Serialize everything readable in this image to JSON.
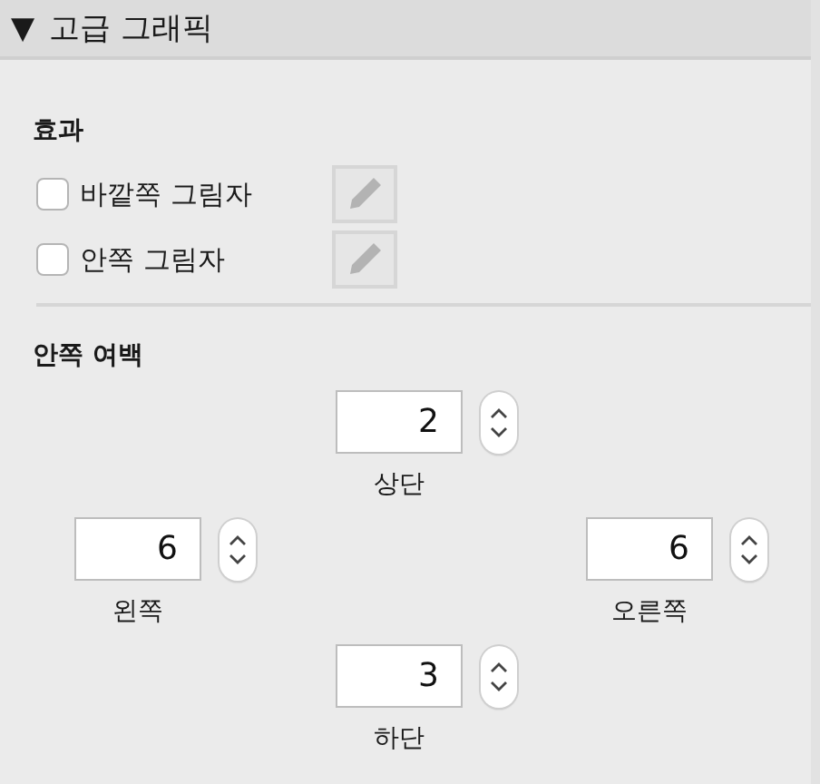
{
  "header": {
    "disclosure": "▼",
    "title": "고급 그래픽",
    "expanded": true
  },
  "effects": {
    "heading": "효과",
    "options": [
      {
        "label": "바깥쪽 그림자",
        "checked": false
      },
      {
        "label": "안쪽 그림자",
        "checked": false
      }
    ]
  },
  "padding": {
    "heading": "안쪽 여백",
    "fields": [
      {
        "kind": "top",
        "label": "상단",
        "value": "2"
      },
      {
        "kind": "left",
        "label": "왼쪽",
        "value": "6"
      },
      {
        "kind": "right",
        "label": "오른쪽",
        "value": "6"
      },
      {
        "kind": "bottom",
        "label": "하단",
        "value": "3"
      }
    ]
  }
}
